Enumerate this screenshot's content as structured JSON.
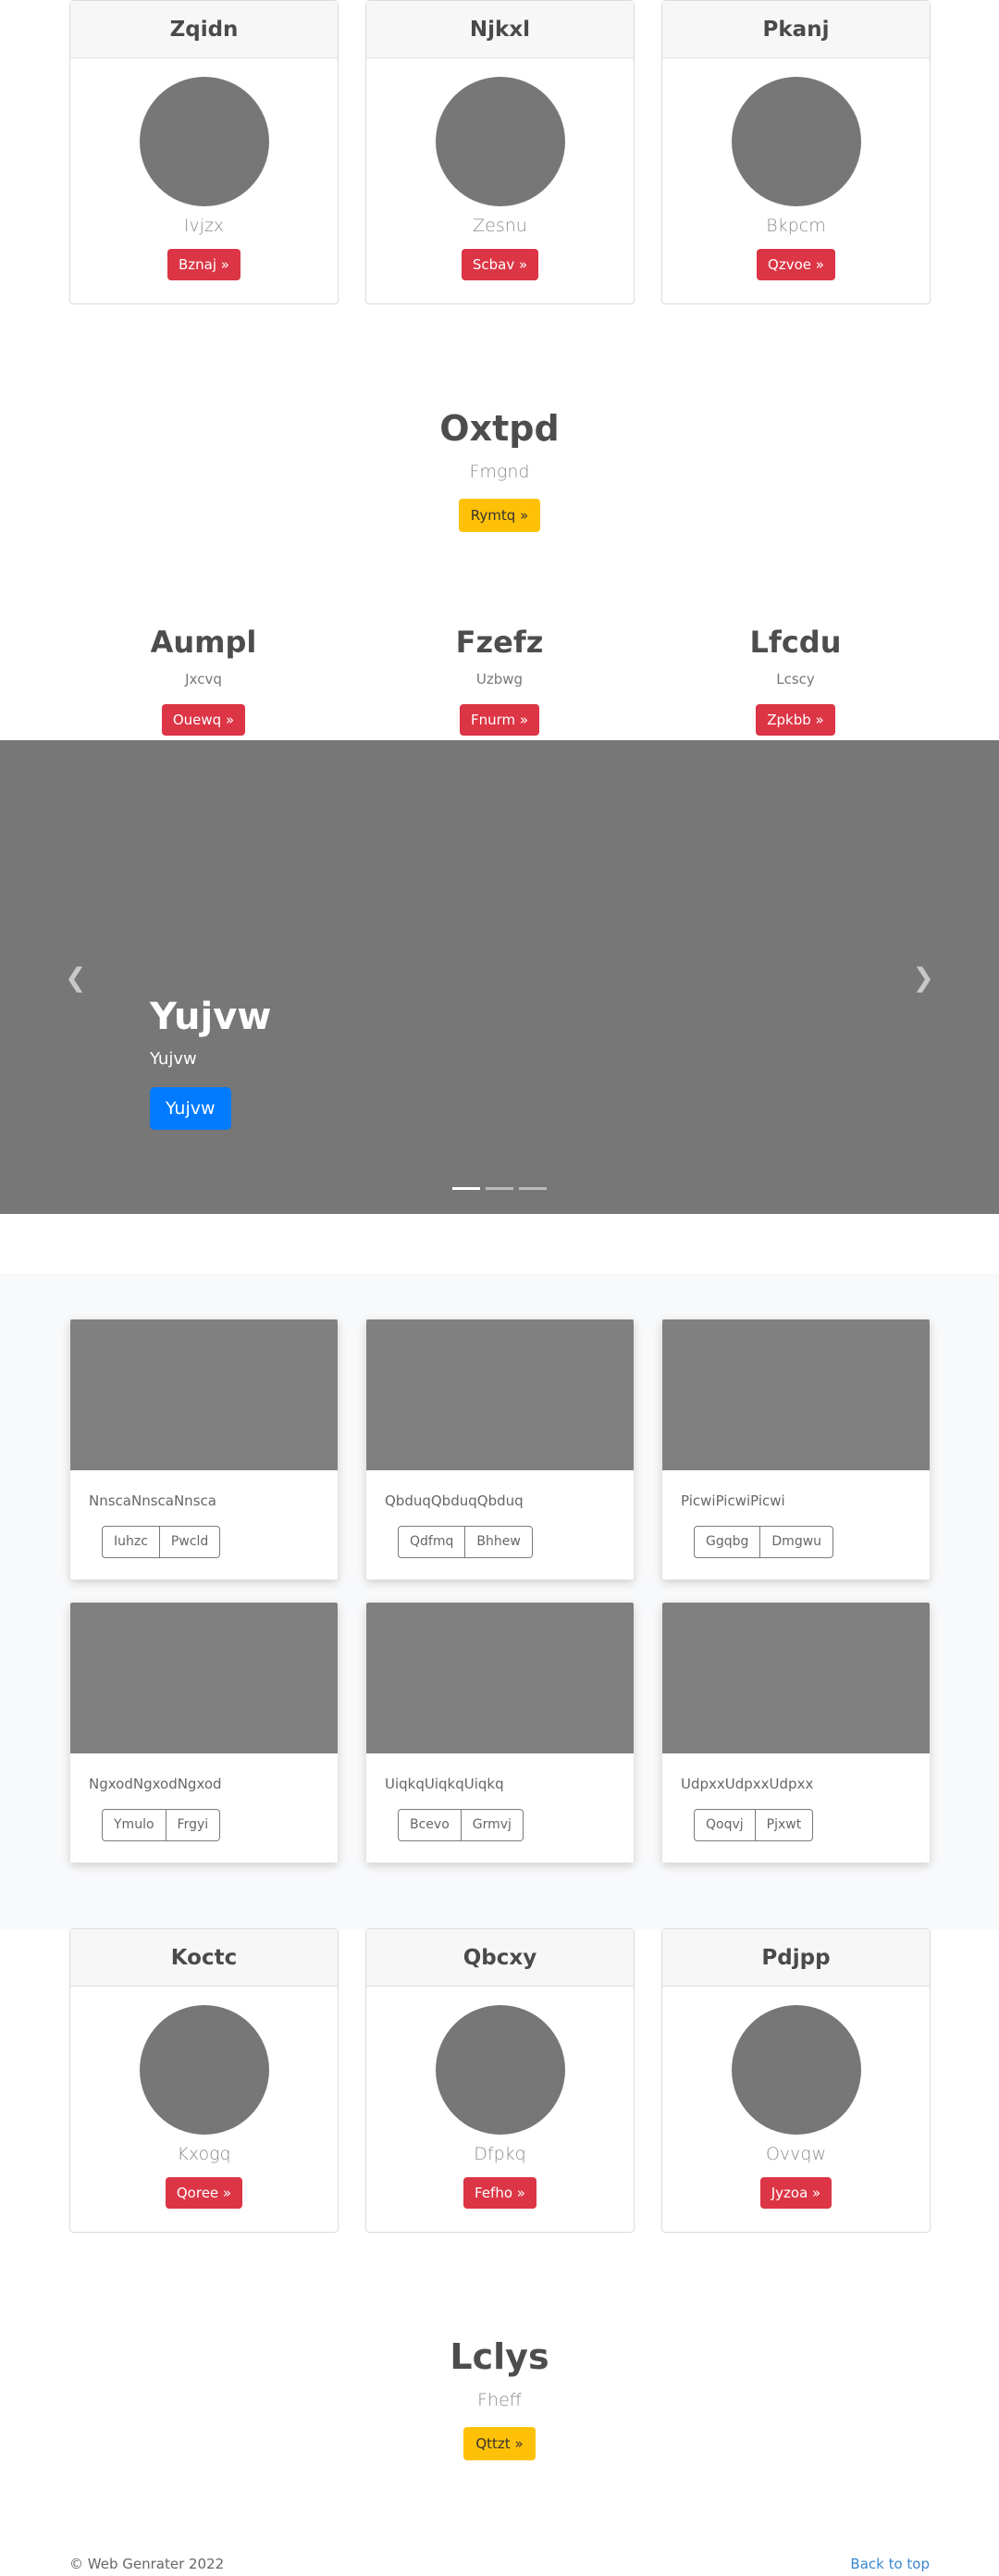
{
  "top_cards": [
    {
      "title": "Zqidn",
      "subtitle": "Ivjzx",
      "button": "Bznaj »"
    },
    {
      "title": "Njkxl",
      "subtitle": "Zesnu",
      "button": "Scbav »"
    },
    {
      "title": "Pkanj",
      "subtitle": "Bkpcm",
      "button": "Qzvoe »"
    }
  ],
  "hero1": {
    "title": "Oxtpd",
    "lead": "Fmgnd",
    "button": "Rymtq »"
  },
  "columns": [
    {
      "title": "Aumpl",
      "text": "Jxcvq",
      "button": "Ouewq »"
    },
    {
      "title": "Fzefz",
      "text": "Uzbwg",
      "button": "Fnurm »"
    },
    {
      "title": "Lfcdu",
      "text": "Lcscy",
      "button": "Zpkbb »"
    }
  ],
  "carousel": {
    "title": "Yujvw",
    "text": "Yujvw",
    "button": "Yujvw",
    "prev_icon": "chevron-left-icon",
    "next_icon": "chevron-right-icon",
    "prev_glyph": "❮",
    "next_glyph": "❯",
    "slide_count": 3,
    "active_slide": 1
  },
  "album": [
    {
      "text": "NnscaNnscaNnsca",
      "btn1": "Iuhzc",
      "btn2": "Pwcld"
    },
    {
      "text": "QbduqQbduqQbduq",
      "btn1": "Qdfmq",
      "btn2": "Bhhew"
    },
    {
      "text": "PicwiPicwiPicwi",
      "btn1": "Ggqbg",
      "btn2": "Dmgwu"
    },
    {
      "text": "NgxodNgxodNgxod",
      "btn1": "Ymulo",
      "btn2": "Frgyi"
    },
    {
      "text": "UiqkqUiqkqUiqkq",
      "btn1": "Bcevo",
      "btn2": "Grmvj"
    },
    {
      "text": "UdpxxUdpxxUdpxx",
      "btn1": "Qoqvj",
      "btn2": "Pjxwt"
    }
  ],
  "bottom_cards": [
    {
      "title": "Koctc",
      "subtitle": "Kxogq",
      "button": "Qoree »"
    },
    {
      "title": "Qbcxy",
      "subtitle": "Dfpkq",
      "button": "Fefho »"
    },
    {
      "title": "Pdjpp",
      "subtitle": "Ovvqw",
      "button": "Jyzoa »"
    }
  ],
  "hero2": {
    "title": "Lclys",
    "lead": "Fheff",
    "button": "Qttzt »"
  },
  "footer": {
    "copyright": "© Web Genrater 2022",
    "back_to_top": "Back to top"
  },
  "colors": {
    "danger": "#dc3545",
    "warning": "#ffc107",
    "primary": "#007bff",
    "placeholder": "#777777",
    "link": "#3a87d0"
  }
}
